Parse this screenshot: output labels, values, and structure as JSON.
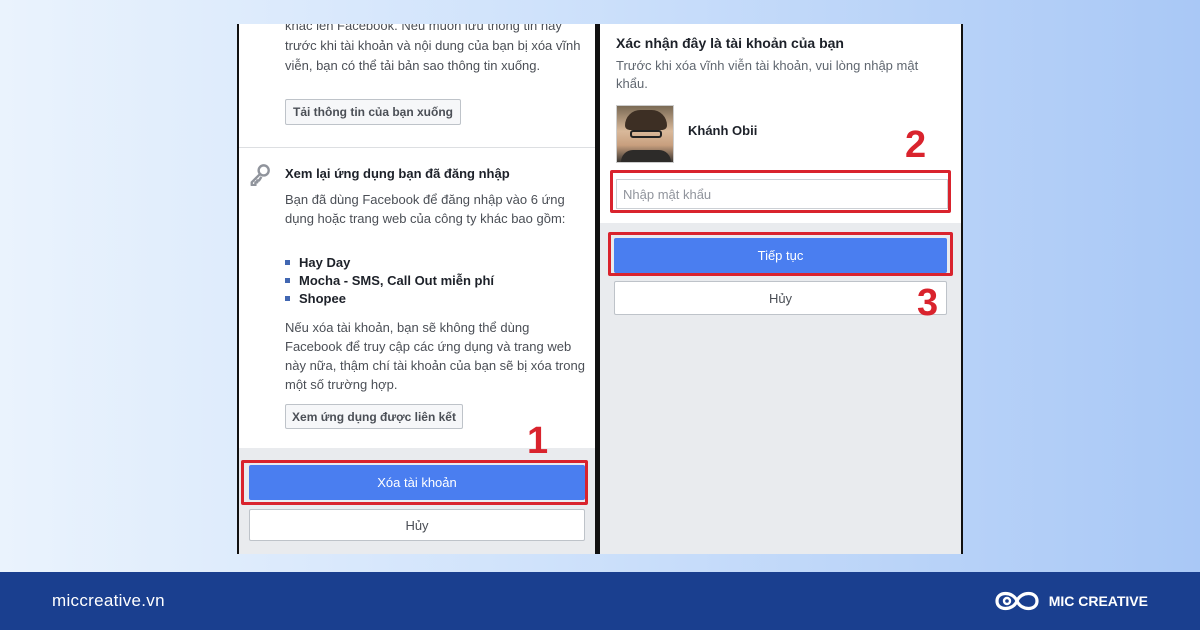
{
  "left_panel": {
    "top_text": "khác lên Facebook. Nếu muốn lưu thông tin này trước khi tài khoản và nội dung của bạn bị xóa vĩnh viễn, bạn có thể tải bản sao thông tin xuống.",
    "download_button": "Tải thông tin của bạn xuống",
    "section_title": "Xem lại ứng dụng bạn đã đăng nhập",
    "section_desc": "Bạn đã dùng Facebook để đăng nhập vào 6 ứng dụng hoặc trang web của công ty khác bao gồm:",
    "apps": [
      "Hay Day",
      "Mocha - SMS, Call Out miễn phí",
      "Shopee"
    ],
    "warning": "Nếu xóa tài khoản, bạn sẽ không thể dùng Facebook để truy cập các ứng dụng và trang web này nữa, thậm chí tài khoản của bạn sẽ bị xóa trong một số trường hợp.",
    "linked_apps_button": "Xem ứng dụng được liên kết",
    "delete_button": "Xóa tài khoản",
    "cancel_button": "Hủy"
  },
  "right_panel": {
    "title": "Xác nhận đây là tài khoản của bạn",
    "desc": "Trước khi xóa vĩnh viễn tài khoản, vui lòng nhập mật khẩu.",
    "user_name": "Khánh Obii",
    "password_placeholder": "Nhập mật khẩu",
    "continue_button": "Tiếp tục",
    "cancel_button": "Hủy"
  },
  "steps": [
    "1",
    "2",
    "3"
  ],
  "footer": {
    "site_url": "miccreative.vn",
    "brand_name": "MIC CREATIVE"
  },
  "colors": {
    "highlight": "#d9232d",
    "primary_button": "#4a7ef0",
    "footer_bg": "#1a3f8f"
  }
}
